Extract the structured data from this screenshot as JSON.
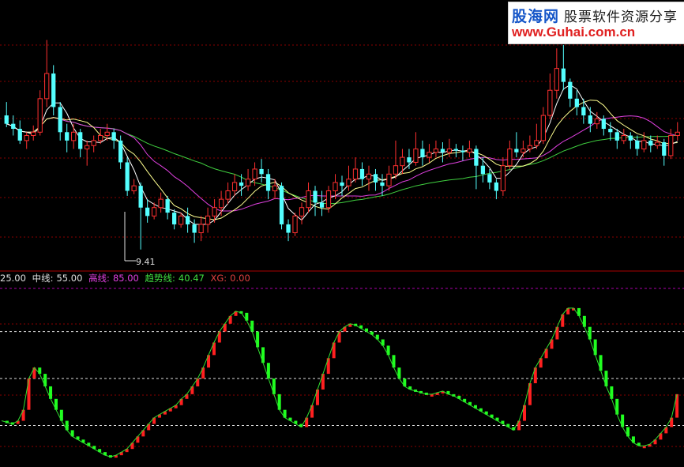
{
  "watermark": {
    "brand": "股海网",
    "slogan": "股票软件资源分享",
    "url": "www.Guhai.com.cn"
  },
  "main_chart": {
    "low_marker": "9.41"
  },
  "legend": {
    "first": "25.00",
    "mid_label": "中线:",
    "mid_value": "55.00",
    "high_label": "高线:",
    "high_value": "85.00",
    "trend_label": "趋势线:",
    "trend_value": "40.47",
    "xg_label": "XG:",
    "xg_value": "0.00"
  },
  "colors": {
    "up": "#ff3030",
    "down": "#54ffff",
    "ma_white": "#ffffff",
    "ma_yellow": "#ffff90",
    "ma_magenta": "#e040e0",
    "ma_green": "#40d040",
    "osc_up": "#ff2020",
    "osc_down": "#20ff20",
    "grid": "#8a0000"
  },
  "chart_data": [
    {
      "type": "candlestick",
      "price_low_label": 9.41,
      "candles": [
        [
          0.5,
          0.45,
          0.58,
          0.43
        ],
        [
          0.45,
          0.42,
          0.5,
          0.38
        ],
        [
          0.42,
          0.35,
          0.47,
          0.33
        ],
        [
          0.35,
          0.38,
          0.4,
          0.3
        ],
        [
          0.38,
          0.4,
          0.44,
          0.35
        ],
        [
          0.4,
          0.6,
          0.65,
          0.38
        ],
        [
          0.6,
          0.75,
          0.95,
          0.55
        ],
        [
          0.75,
          0.55,
          0.8,
          0.5
        ],
        [
          0.55,
          0.4,
          0.58,
          0.35
        ],
        [
          0.4,
          0.35,
          0.45,
          0.28
        ],
        [
          0.35,
          0.4,
          0.45,
          0.3
        ],
        [
          0.4,
          0.3,
          0.42,
          0.25
        ],
        [
          0.3,
          0.32,
          0.35,
          0.2
        ],
        [
          0.32,
          0.35,
          0.38,
          0.28
        ],
        [
          0.35,
          0.38,
          0.42,
          0.33
        ],
        [
          0.38,
          0.4,
          0.45,
          0.35
        ],
        [
          0.4,
          0.35,
          0.42,
          0.3
        ],
        [
          0.35,
          0.22,
          0.38,
          0.18
        ],
        [
          0.22,
          0.05,
          0.25,
          0.02
        ],
        [
          0.05,
          0.08,
          0.12,
          0.03
        ],
        [
          0.08,
          -0.05,
          0.1,
          -0.3
        ],
        [
          -0.05,
          -0.1,
          0.0,
          -0.14
        ],
        [
          -0.1,
          -0.05,
          -0.02,
          -0.12
        ],
        [
          -0.05,
          0.0,
          0.04,
          -0.08
        ],
        [
          0.0,
          -0.08,
          0.02,
          -0.12
        ],
        [
          -0.08,
          -0.15,
          -0.06,
          -0.18
        ],
        [
          -0.15,
          -0.1,
          -0.08,
          -0.17
        ],
        [
          -0.1,
          -0.15,
          -0.05,
          -0.2
        ],
        [
          -0.15,
          -0.2,
          -0.12,
          -0.26
        ],
        [
          -0.2,
          -0.15,
          -0.1,
          -0.25
        ],
        [
          -0.15,
          -0.1,
          -0.05,
          -0.2
        ],
        [
          -0.1,
          -0.05,
          0.0,
          -0.14
        ],
        [
          -0.05,
          0.0,
          0.05,
          -0.1
        ],
        [
          0.0,
          0.05,
          0.1,
          -0.03
        ],
        [
          0.05,
          0.1,
          0.15,
          0.02
        ],
        [
          0.1,
          0.08,
          0.15,
          0.02
        ],
        [
          0.08,
          0.12,
          0.18,
          0.05
        ],
        [
          0.12,
          0.18,
          0.22,
          0.08
        ],
        [
          0.18,
          0.15,
          0.24,
          0.1
        ],
        [
          0.15,
          0.05,
          0.18,
          0.0
        ],
        [
          0.05,
          0.08,
          0.12,
          0.0
        ],
        [
          0.08,
          -0.15,
          0.1,
          -0.18
        ],
        [
          -0.15,
          -0.2,
          -0.12,
          -0.25
        ],
        [
          -0.2,
          -0.1,
          -0.08,
          -0.22
        ],
        [
          -0.1,
          -0.05,
          -0.02,
          -0.15
        ],
        [
          -0.05,
          0.05,
          0.1,
          -0.08
        ],
        [
          0.05,
          -0.02,
          0.08,
          -0.1
        ],
        [
          -0.02,
          -0.05,
          0.05,
          -0.1
        ],
        [
          -0.05,
          0.05,
          0.08,
          -0.08
        ],
        [
          0.05,
          0.1,
          0.15,
          0.0
        ],
        [
          0.1,
          0.08,
          0.14,
          0.02
        ],
        [
          0.08,
          0.12,
          0.2,
          0.05
        ],
        [
          0.12,
          0.18,
          0.25,
          0.1
        ],
        [
          0.18,
          0.12,
          0.22,
          0.08
        ],
        [
          0.12,
          0.15,
          0.2,
          0.05
        ],
        [
          0.15,
          0.1,
          0.18,
          0.05
        ],
        [
          0.1,
          0.08,
          0.15,
          0.02
        ],
        [
          0.08,
          0.15,
          0.2,
          0.05
        ],
        [
          0.15,
          0.2,
          0.35,
          0.12
        ],
        [
          0.2,
          0.25,
          0.3,
          0.15
        ],
        [
          0.25,
          0.22,
          0.3,
          0.18
        ],
        [
          0.22,
          0.3,
          0.4,
          0.2
        ],
        [
          0.3,
          0.25,
          0.35,
          0.2
        ],
        [
          0.25,
          0.28,
          0.33,
          0.22
        ],
        [
          0.28,
          0.3,
          0.35,
          0.25
        ],
        [
          0.3,
          0.28,
          0.34,
          0.22
        ],
        [
          0.28,
          0.3,
          0.36,
          0.25
        ],
        [
          0.3,
          0.29,
          0.33,
          0.25
        ],
        [
          0.29,
          0.28,
          0.32,
          0.23
        ],
        [
          0.28,
          0.3,
          0.35,
          0.25
        ],
        [
          0.3,
          0.2,
          0.32,
          0.06
        ],
        [
          0.2,
          0.15,
          0.25,
          0.1
        ],
        [
          0.15,
          0.1,
          0.18,
          0.06
        ],
        [
          0.1,
          0.05,
          0.12,
          0.0
        ],
        [
          0.05,
          0.2,
          0.25,
          0.02
        ],
        [
          0.2,
          0.3,
          0.35,
          0.18
        ],
        [
          0.3,
          0.28,
          0.4,
          0.25
        ],
        [
          0.28,
          0.3,
          0.35,
          0.25
        ],
        [
          0.3,
          0.32,
          0.38,
          0.28
        ],
        [
          0.32,
          0.35,
          0.45,
          0.3
        ],
        [
          0.35,
          0.5,
          0.55,
          0.33
        ],
        [
          0.5,
          0.65,
          0.75,
          0.48
        ],
        [
          0.65,
          0.78,
          0.9,
          0.6
        ],
        [
          0.78,
          0.7,
          0.92,
          0.65
        ],
        [
          0.7,
          0.6,
          0.72,
          0.55
        ],
        [
          0.6,
          0.55,
          0.65,
          0.5
        ],
        [
          0.55,
          0.5,
          0.6,
          0.45
        ],
        [
          0.5,
          0.45,
          0.55,
          0.4
        ],
        [
          0.45,
          0.48,
          0.52,
          0.42
        ],
        [
          0.48,
          0.42,
          0.5,
          0.38
        ],
        [
          0.42,
          0.4,
          0.46,
          0.35
        ],
        [
          0.4,
          0.35,
          0.42,
          0.3
        ],
        [
          0.35,
          0.38,
          0.42,
          0.33
        ],
        [
          0.38,
          0.35,
          0.4,
          0.3
        ],
        [
          0.35,
          0.3,
          0.38,
          0.26
        ],
        [
          0.3,
          0.35,
          0.4,
          0.28
        ],
        [
          0.35,
          0.32,
          0.38,
          0.28
        ],
        [
          0.32,
          0.34,
          0.38,
          0.3
        ],
        [
          0.34,
          0.26,
          0.36,
          0.2
        ],
        [
          0.26,
          0.38,
          0.42,
          0.24
        ],
        [
          0.38,
          0.4,
          0.46,
          0.35
        ]
      ],
      "note": "candle values [open, close, high, low] in relative price units"
    },
    {
      "type": "line",
      "name": "oscillator",
      "levels": {
        "low": 25.0,
        "mid": 55.0,
        "high": 85.0
      },
      "trend_value": 40.47,
      "xg_value": 0.0,
      "ylim": [
        0,
        105
      ],
      "values": [
        28,
        27,
        26,
        28,
        35,
        55,
        62,
        58,
        50,
        42,
        35,
        28,
        22,
        18,
        16,
        14,
        12,
        10,
        8,
        6,
        5,
        6,
        8,
        10,
        14,
        18,
        22,
        26,
        30,
        32,
        34,
        36,
        38,
        42,
        45,
        50,
        55,
        62,
        70,
        78,
        85,
        90,
        95,
        98,
        97,
        92,
        85,
        75,
        65,
        55,
        45,
        35,
        30,
        28,
        26,
        24,
        30,
        38,
        48,
        58,
        68,
        78,
        85,
        88,
        90,
        89,
        87,
        85,
        83,
        80,
        76,
        70,
        62,
        55,
        50,
        48,
        47,
        46,
        45,
        45,
        46,
        47,
        45,
        44,
        42,
        40,
        38,
        36,
        34,
        32,
        30,
        28,
        26,
        24,
        22,
        28,
        38,
        52,
        62,
        68,
        74,
        80,
        88,
        96,
        100,
        100,
        95,
        88,
        80,
        70,
        60,
        50,
        42,
        32,
        24,
        18,
        14,
        12,
        12,
        13,
        16,
        20,
        24,
        30,
        45
      ]
    }
  ]
}
